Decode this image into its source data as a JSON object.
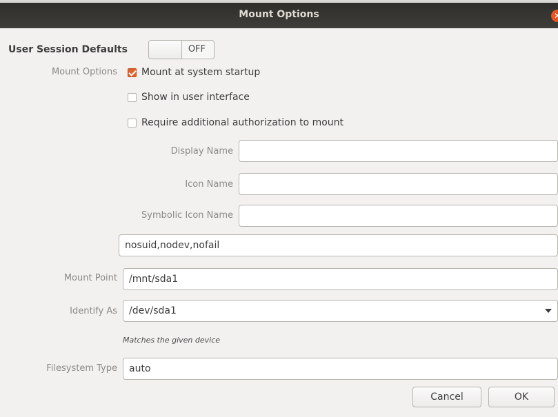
{
  "window": {
    "title": "Mount Options",
    "close_glyph": "✕"
  },
  "defaults": {
    "heading": "User Session Defaults",
    "switch_state": "OFF"
  },
  "mount_options": {
    "label": "Mount Options",
    "checkboxes": [
      {
        "label": "Mount at system startup",
        "checked": true
      },
      {
        "label": "Show in user interface",
        "checked": false
      },
      {
        "label": "Require additional authorization to mount",
        "checked": false
      }
    ]
  },
  "fields": {
    "display_name": {
      "label": "Display Name",
      "value": ""
    },
    "icon_name": {
      "label": "Icon Name",
      "value": ""
    },
    "symbolic_icon_name": {
      "label": "Symbolic Icon Name",
      "value": ""
    },
    "options": {
      "value": "nosuid,nodev,nofail"
    },
    "mount_point": {
      "label": "Mount Point",
      "value": "/mnt/sda1"
    },
    "identify_as": {
      "label": "Identify As",
      "value": "/dev/sda1",
      "hint": "Matches the given device"
    },
    "filesystem_type": {
      "label": "Filesystem Type",
      "value": "auto"
    }
  },
  "buttons": {
    "cancel": "Cancel",
    "ok": "OK"
  },
  "colors": {
    "accent": "#e0622c",
    "titlebar": "#3e3d39",
    "background": "#f2f1f0"
  }
}
